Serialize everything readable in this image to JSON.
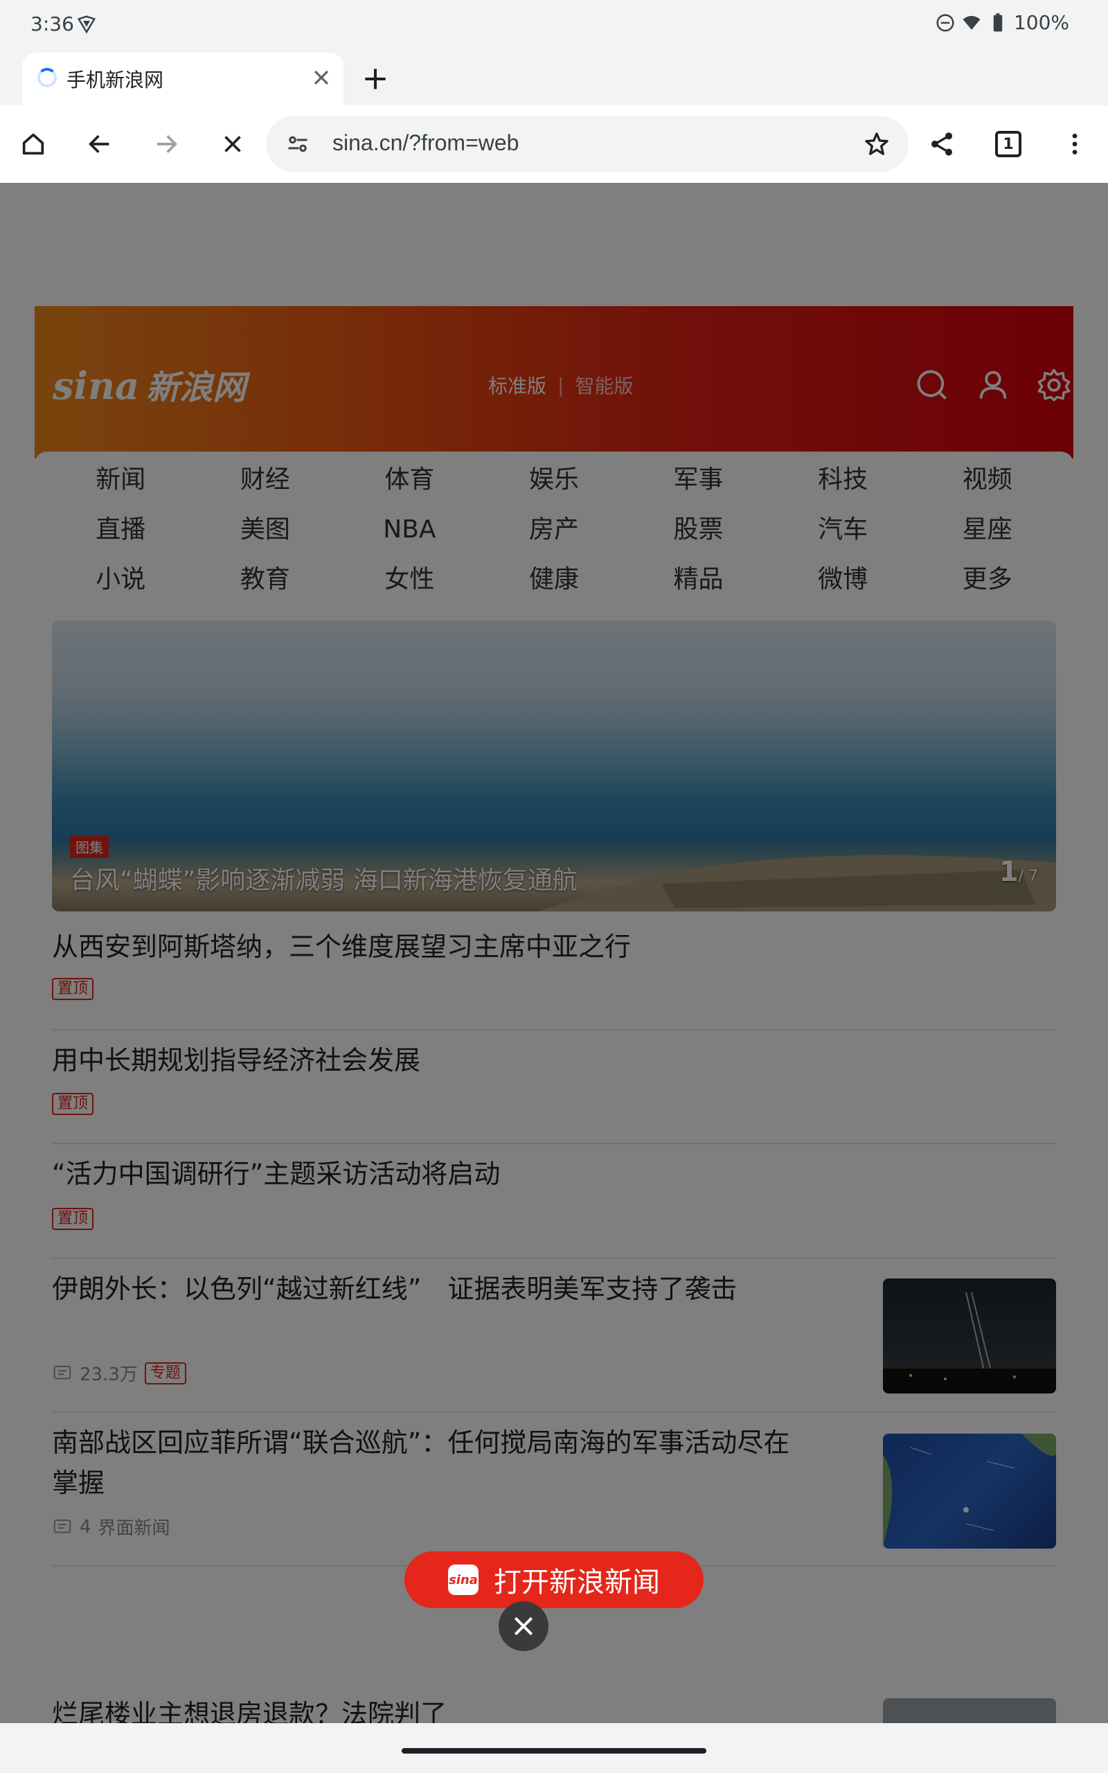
{
  "status_bar": {
    "time": "3:36",
    "battery": "100%"
  },
  "tab": {
    "title": "手机新浪网"
  },
  "omnibox": {
    "url": "sina.cn/?from=web"
  },
  "toolbar": {
    "tab_count": "1"
  },
  "header": {
    "logo_latin": "sina",
    "logo_text": "新浪网",
    "mode_standard": "标准版",
    "mode_separator": "|",
    "mode_smart": "智能版"
  },
  "nav": {
    "items": [
      "新闻",
      "财经",
      "体育",
      "娱乐",
      "军事",
      "科技",
      "视频",
      "直播",
      "美图",
      "NBA",
      "房产",
      "股票",
      "汽车",
      "星座",
      "小说",
      "教育",
      "女性",
      "健康",
      "精品",
      "微博",
      "更多"
    ]
  },
  "hero": {
    "tag": "图集",
    "caption": "台风“蝴蝶”影响逐渐减弱 海口新海港恢复通航",
    "counter_current": "1",
    "counter_total": "/ 7"
  },
  "news": [
    {
      "headline": "从西安到阿斯塔纳，三个维度展望习主席中亚之行",
      "badge": "置顶"
    },
    {
      "headline": "用中长期规划指导经济社会发展",
      "badge": "置顶"
    },
    {
      "headline": "“活力中国调研行”主题采访活动将启动",
      "badge": "置顶"
    },
    {
      "headline": "伊朗外长：以色列“越过新红线”　证据表明美军支持了袭击",
      "comments": "23.3万",
      "badge": "专题"
    },
    {
      "headline_line1": "南部战区回应菲所谓“联合巡航”：任何搅局南海的军事活动尽在",
      "headline_line2": "掌握",
      "comments": "4",
      "source": "界面新闻"
    },
    {
      "headline": "烂尾楼业主想退房退款？法院判了"
    }
  ],
  "open_app": {
    "label": "打开新浪新闻",
    "logo": "sina"
  },
  "colors": {
    "brand_red": "#e5261b",
    "header_orange": "#f08a1c",
    "header_red": "#d8000f"
  }
}
